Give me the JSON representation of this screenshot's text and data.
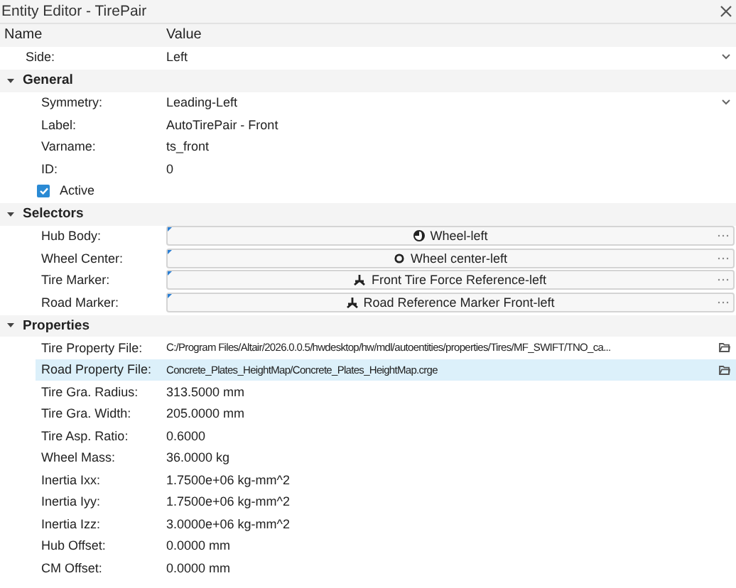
{
  "window": {
    "title": "Entity Editor - TirePair"
  },
  "columns": [
    "Name",
    "Value"
  ],
  "rows": [
    {
      "kind": "dropdown",
      "label": "Side:",
      "value": "Left",
      "selected": false
    }
  ],
  "sections": [
    {
      "title": "General",
      "expanded": true,
      "rows": [
        {
          "kind": "dropdown",
          "label": "Symmetry:",
          "value": "Leading-Left",
          "selected": false
        },
        {
          "kind": "text",
          "label": "Label:",
          "value": "AutoTirePair - Front",
          "selected": false
        },
        {
          "kind": "text",
          "label": "Varname:",
          "value": "ts_front",
          "selected": false
        },
        {
          "kind": "text",
          "label": "ID:",
          "value": "0",
          "selected": false
        },
        {
          "kind": "checkbox",
          "label": "Active",
          "checked": true,
          "selected": false
        }
      ]
    },
    {
      "title": "Selectors",
      "expanded": true,
      "rows": [
        {
          "kind": "body_selector",
          "label": "Hub Body:",
          "value": "Wheel-left",
          "selected": false
        },
        {
          "kind": "point_selector",
          "label": "Wheel Center:",
          "value": "Wheel center-left",
          "selected": false
        },
        {
          "kind": "marker_selector",
          "label": "Tire Marker:",
          "value": "Front Tire Force Reference-left",
          "selected": false
        },
        {
          "kind": "marker_selector",
          "label": "Road Marker:",
          "value": "Road Reference Marker Front-left",
          "selected": false
        }
      ]
    },
    {
      "title": "Properties",
      "expanded": true,
      "rows": [
        {
          "kind": "file",
          "label": "Tire Property File:",
          "value": "C:/Program Files/Altair/2026.0.0.5/hwdesktop/hw/mdl/autoentities/properties/Tires/MF_SWIFT/TNO_ca...",
          "selected": false
        },
        {
          "kind": "file",
          "label": "Road Property File:",
          "value": "Concrete_Plates_HeightMap/Concrete_Plates_HeightMap.crge",
          "selected": true
        },
        {
          "kind": "text",
          "label": "Tire Gra. Radius:",
          "value": "313.5000 mm",
          "selected": false
        },
        {
          "kind": "text",
          "label": "Tire Gra. Width:",
          "value": "205.0000 mm",
          "selected": false
        },
        {
          "kind": "text",
          "label": "Tire Asp. Ratio:",
          "value": "0.6000",
          "selected": false
        },
        {
          "kind": "text",
          "label": "Wheel Mass:",
          "value": "36.0000 kg",
          "selected": false
        },
        {
          "kind": "text",
          "label": "Inertia Ixx:",
          "value": "1.7500e+06 kg-mm^2",
          "selected": false
        },
        {
          "kind": "text",
          "label": "Inertia Iyy:",
          "value": "1.7500e+06 kg-mm^2",
          "selected": false
        },
        {
          "kind": "text",
          "label": "Inertia Izz:",
          "value": "3.0000e+06 kg-mm^2",
          "selected": false
        },
        {
          "kind": "text",
          "label": "Hub Offset:",
          "value": "0.0000 mm",
          "selected": false
        },
        {
          "kind": "text",
          "label": "CM Offset:",
          "value": "0.0000 mm",
          "selected": false
        }
      ]
    }
  ]
}
